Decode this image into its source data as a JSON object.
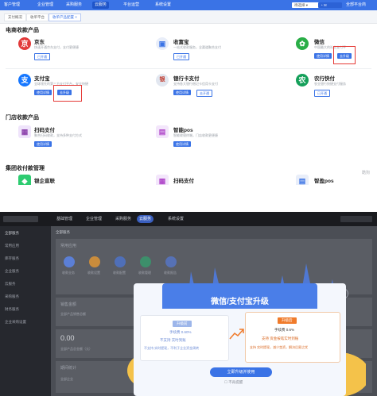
{
  "top_nav": {
    "items": [
      "客户管理",
      "企业管理",
      "采购服务",
      "云服务",
      "平台运营",
      "系统设置"
    ],
    "active_index": 3,
    "select_value": "待选择",
    "user_label": "全部平台商"
  },
  "tabs": [
    "支付概况",
    "收单平台",
    "收单产品配置"
  ],
  "sections": {
    "ecommerce": "电商收款产品",
    "store": "门店收款产品",
    "group": "集团收付款管理"
  },
  "products": {
    "jd": {
      "name": "京东",
      "desc": "快速开通京东支付，支付更便捷",
      "btn1": "已开通"
    },
    "shouyinbao": {
      "name": "收富宝",
      "desc": "一站式收款服务，全渠道聚合支付",
      "btn1": "已开通"
    },
    "wechat": {
      "name": "微信",
      "desc": "中国最大的社交支付平台",
      "btn1": "使用详情",
      "btn2": "去升级"
    },
    "alipay": {
      "name": "支付宝",
      "desc": "全球领先的第三方支付平台，安全快捷",
      "btn1": "使用详情",
      "btn2": "去升级"
    },
    "unionpay": {
      "name": "银行卡支付",
      "desc": "支持各大银行借记卡信用卡支付",
      "btn1": "使用详情",
      "btn2": "去开通"
    },
    "abc": {
      "name": "农行快付",
      "desc": "农业银行快捷支付服务",
      "btn1": "已开通"
    },
    "scan": {
      "name": "扫码支付",
      "desc": "聚合扫码收款，支持多种支付方式",
      "btn1": "使用详情"
    },
    "pos": {
      "name": "智能pos",
      "desc": "智能收银终端，门店收款更便捷",
      "btn1": "使用详情"
    },
    "bank": {
      "name": "银企直联"
    },
    "scan2": {
      "name": "扫码支付"
    },
    "smartpos": {
      "name": "智盈pos"
    }
  },
  "watermark": "酷狗",
  "bottom_nav": {
    "items": [
      "基础管理",
      "企业管理",
      "采购服务",
      "云服务",
      "系统设置"
    ],
    "active_index": 3
  },
  "bottom_sidebar": [
    "全部服务",
    "常用应用",
    "库存服务",
    "企业服务",
    "云服务",
    "采购服务",
    "财务服务",
    "企业采购设置"
  ],
  "bottom_main": {
    "tab": "全部服务",
    "section_common": "常用应用",
    "apps": [
      "收款业务",
      "收款设置",
      "收款配置",
      "收款管理",
      "收款报告"
    ],
    "section_sales": "销售金额",
    "section_sales_sub": "全部产品销售总额",
    "amount": "0.00",
    "amount_sub": "全部产品总金额（元）",
    "section_period": "期间统计",
    "period_sub": "全部企业"
  },
  "modal": {
    "title": "微信/支付宝升级",
    "left": {
      "tag": "升级前",
      "fee": "手续费 0.60%",
      "line1": "不支持 实时到账",
      "line2": "不支持 实时提现，不利于企业资金周转"
    },
    "right": {
      "tag": "升级后",
      "fee": "手续费 0.6%",
      "line1": "支持 资金按笔实时到账",
      "line2": "支持 实时提现，减少垫资，解决后顾之忧"
    },
    "button": "立即升级并使用",
    "footnote": "不再提醒"
  },
  "colors": {
    "primary": "#3a73e6",
    "highlight": "#e53935",
    "upgrade_orange": "#f07b2b",
    "dark_overlay": "#3b3d44"
  }
}
